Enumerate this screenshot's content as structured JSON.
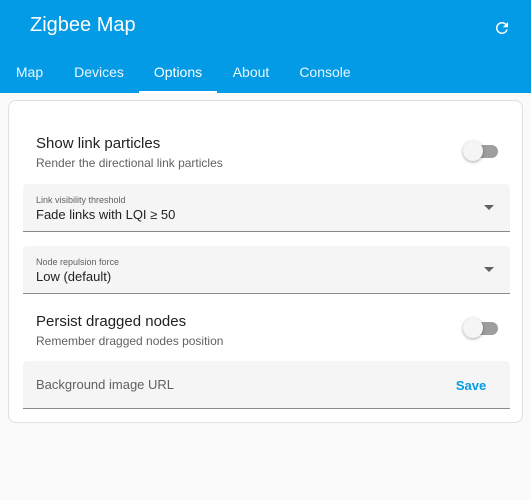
{
  "app": {
    "title": "Zigbee Map"
  },
  "header": {
    "refresh_icon": "refresh-icon"
  },
  "tabs": [
    {
      "label": "Map",
      "active": false
    },
    {
      "label": "Devices",
      "active": false
    },
    {
      "label": "Options",
      "active": true
    },
    {
      "label": "About",
      "active": false
    },
    {
      "label": "Console",
      "active": false
    }
  ],
  "options": {
    "link_particles": {
      "title": "Show link particles",
      "subtitle": "Render the directional link particles",
      "enabled": false
    },
    "link_visibility": {
      "label": "Link visibility threshold",
      "value": "Fade links with LQI ≥ 50"
    },
    "node_repulsion": {
      "label": "Node repulsion force",
      "value": "Low (default)"
    },
    "persist_nodes": {
      "title": "Persist dragged nodes",
      "subtitle": "Remember dragged nodes position",
      "enabled": false
    },
    "background_url": {
      "placeholder": "Background image URL",
      "value": "",
      "save_label": "Save"
    }
  },
  "colors": {
    "primary": "#039be5",
    "background": "#fafafa",
    "card": "#ffffff",
    "field": "#f5f5f5",
    "switch_off_track": "#9e9e9e"
  }
}
